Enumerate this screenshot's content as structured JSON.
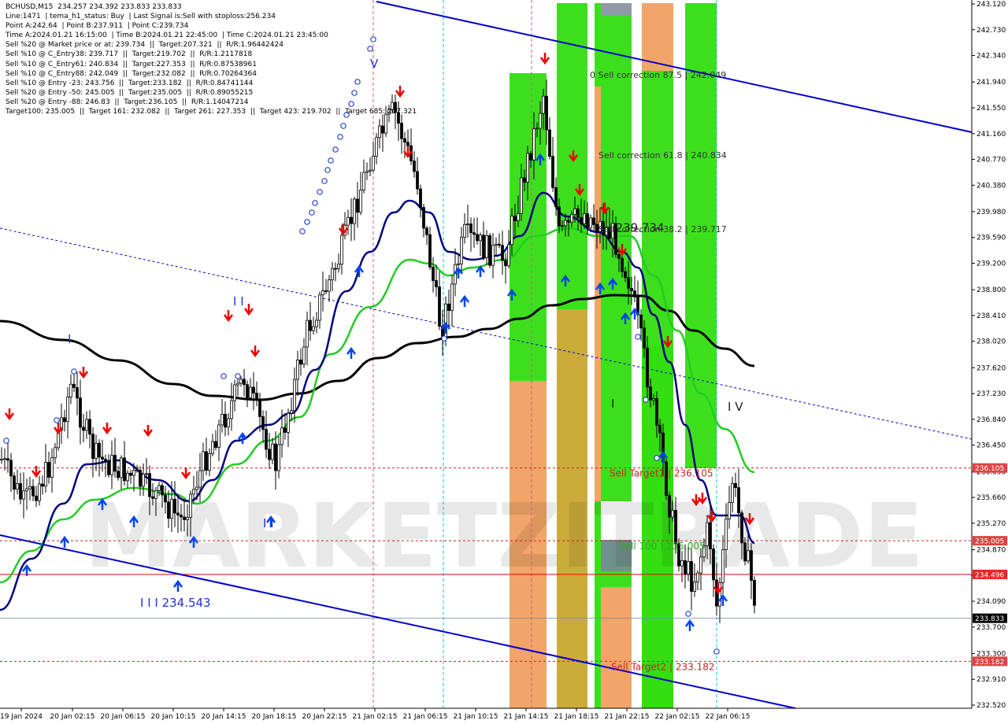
{
  "header": {
    "lines": [
      "BCHUSD,M15  234.257 234.392 233.833 233.833",
      "Line:1471  | tema_h1_status: Buy  | Last Signal is:Sell with stoploss:256.234",
      "Point A:242.64  | Point B:237.911  | Point C:239.734",
      "Time A:2024.01.21 16:15:00  | Time B:2024.01.21 22:45:00  | Time C:2024.01.21 23:45:00",
      "Sell %20 @ Market price or at: 239.734  ||  Target:207.321  ||  R/R:1.96442424",
      "Sell %10 @ C_Entry38: 239.717  ||  Target:219.702  ||  R/R:1.2117818",
      "Sell %10 @ C_Entry61: 240.834  ||  Target:227.353  ||  R/R:0.87538961",
      "Sell %10 @ C_Entry88: 242.049  ||  Target:232.082  ||  R/R:0.70264364",
      "Sell %10 @ Entry -23: 243.756  ||  Target:233.182  ||  R/R:0.84741144",
      "Sell %20 @ Entry -50: 245.005  ||  Target:235.005  ||  R/R:0.89055215",
      "Sell %20 @ Entry -88: 246.83  ||  Target:236.105  ||  R/R:1.14047214",
      "Target100: 235.005  ||  Target 161: 232.082  ||  Target 261: 227.353  ||  Target 423: 219.702  ||  Target 685: 207.321"
    ]
  },
  "watermark": "MARKETZITRADE",
  "colors": {
    "green_zone": "#33dd11",
    "orange_zone": "#f0a060",
    "dark_yellow_zone": "#c8a830",
    "channel": "#0000cc",
    "ema_green": "#22cc22",
    "ema_navy": "#000080",
    "ma_black": "#000000",
    "red_line": "#ee0000",
    "target_dash": "#cc2222"
  },
  "chart_data": {
    "type": "candlestick",
    "symbol": "BCHUSD",
    "timeframe": "M15",
    "ylim": [
      232.52,
      243.12
    ],
    "y_ticks": [
      "243.120",
      "242.730",
      "242.340",
      "241.940",
      "241.550",
      "241.160",
      "240.770",
      "240.380",
      "239.980",
      "239.590",
      "239.200",
      "238.800",
      "238.410",
      "238.020",
      "237.620",
      "237.230",
      "236.840",
      "236.450",
      "236.050",
      "235.660",
      "235.270",
      "234.870",
      "234.480",
      "234.090",
      "233.700",
      "233.300",
      "232.910",
      "232.520"
    ],
    "x_ticks": [
      "19 Jan 2024",
      "20 Jan 02:15",
      "20 Jan 06:15",
      "20 Jan 10:15",
      "20 Jan 14:15",
      "20 Jan 18:15",
      "20 Jan 22:15",
      "21 Jan 02:15",
      "21 Jan 06:15",
      "21 Jan 10:15",
      "21 Jan 14:15",
      "21 Jan 18:15",
      "21 Jan 22:15",
      "22 Jan 02:15",
      "22 Jan 06:15"
    ],
    "price_labels": [
      {
        "value": 236.105,
        "text": "236.105",
        "style": "target"
      },
      {
        "value": 235.005,
        "text": "235.005",
        "style": "target"
      },
      {
        "value": 234.496,
        "text": "234.496",
        "style": "red"
      },
      {
        "value": 233.833,
        "text": "233.833",
        "style": "current"
      },
      {
        "value": 233.182,
        "text": "233.182",
        "style": "target"
      }
    ],
    "annotations": [
      {
        "text": "0 Sell correction 87.5 | 242.049",
        "value": 242.049
      },
      {
        "text": "Sell correction 61.8 | 240.834",
        "value": 240.834
      },
      {
        "text": "I I I 239.734",
        "value": 239.734
      },
      {
        "text": "Sell correction 38.2 | 239.717",
        "value": 239.717
      },
      {
        "text": "Sell Target1 | 236.105",
        "value": 236.105
      },
      {
        "text": "Sell 100 | 235.005",
        "value": 235.005
      },
      {
        "text": "Sell Target2 | 233.182",
        "value": 233.182
      },
      {
        "text": "I I I 234.543",
        "value": 234.543
      }
    ],
    "wave_labels": [
      "I",
      "I I",
      "I I",
      "V",
      "I",
      "I V"
    ]
  }
}
